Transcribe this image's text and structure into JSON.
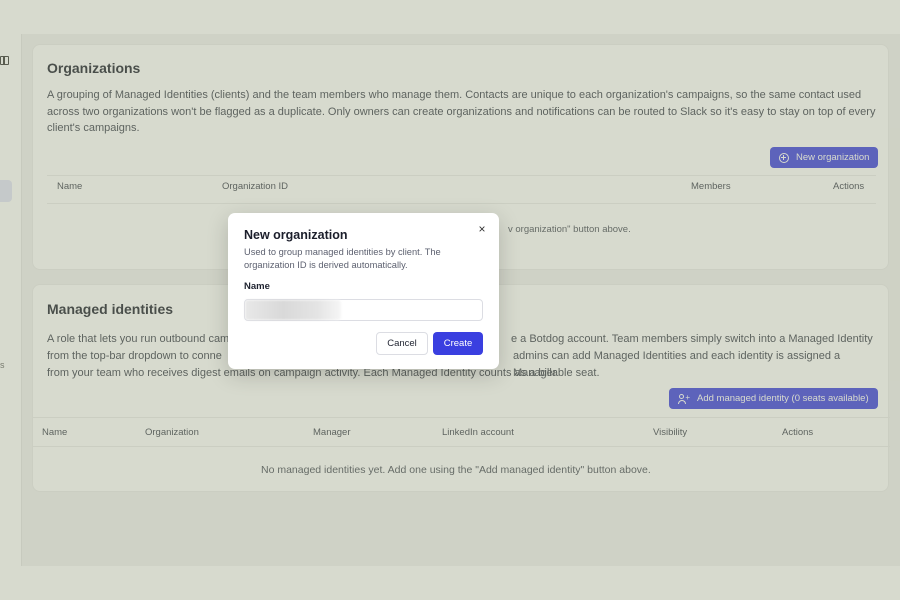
{
  "organizations": {
    "title": "Organizations",
    "description": "A grouping of Managed Identities (clients) and the team members who manage them. Contacts are unique to each organization's campaigns, so the same contact used across two organizations won't be flagged as a duplicate. Only owners can create organizations and notifications can be routed to Slack so it's easy to stay on top of every client's campaigns.",
    "new_button": "New organization",
    "columns": [
      "Name",
      "Organization ID",
      "Members",
      "Actions"
    ],
    "empty_partial": "v organization\" button above."
  },
  "managed_identities": {
    "title": "Managed identities",
    "description_line1_left": "A role that lets you run outbound cam",
    "description_line1_right": "e a Botdog account. Team members simply switch into a Managed Identity",
    "description_line2_left": "from the top-bar dropdown to conne",
    "description_line2_right": "admins can add Managed Identities and each identity is assigned a Manager",
    "description_line3": "from your team who receives digest emails on campaign activity. Each Managed Identity counts as a billable seat.",
    "add_button": "Add managed identity (0 seats available)",
    "columns": [
      "Name",
      "Organization",
      "Manager",
      "LinkedIn account",
      "Visibility",
      "Actions"
    ],
    "empty_text": "No managed identities yet. Add one using the \"Add managed identity\" button above."
  },
  "modal": {
    "title": "New organization",
    "close_glyph": "×",
    "description": "Used to group managed identities by client. The organization ID is derived automatically.",
    "name_label": "Name",
    "name_value": "",
    "cancel_label": "Cancel",
    "create_label": "Create"
  },
  "colors": {
    "accent": "#3a3fe0",
    "overlay": "#969e7d"
  },
  "icons": {
    "new_organization": "plus-circle-icon",
    "add_managed_identity": "user-plus-icon",
    "close": "close-icon",
    "sidebar_toggle": "sidebar-toggle-icon"
  }
}
